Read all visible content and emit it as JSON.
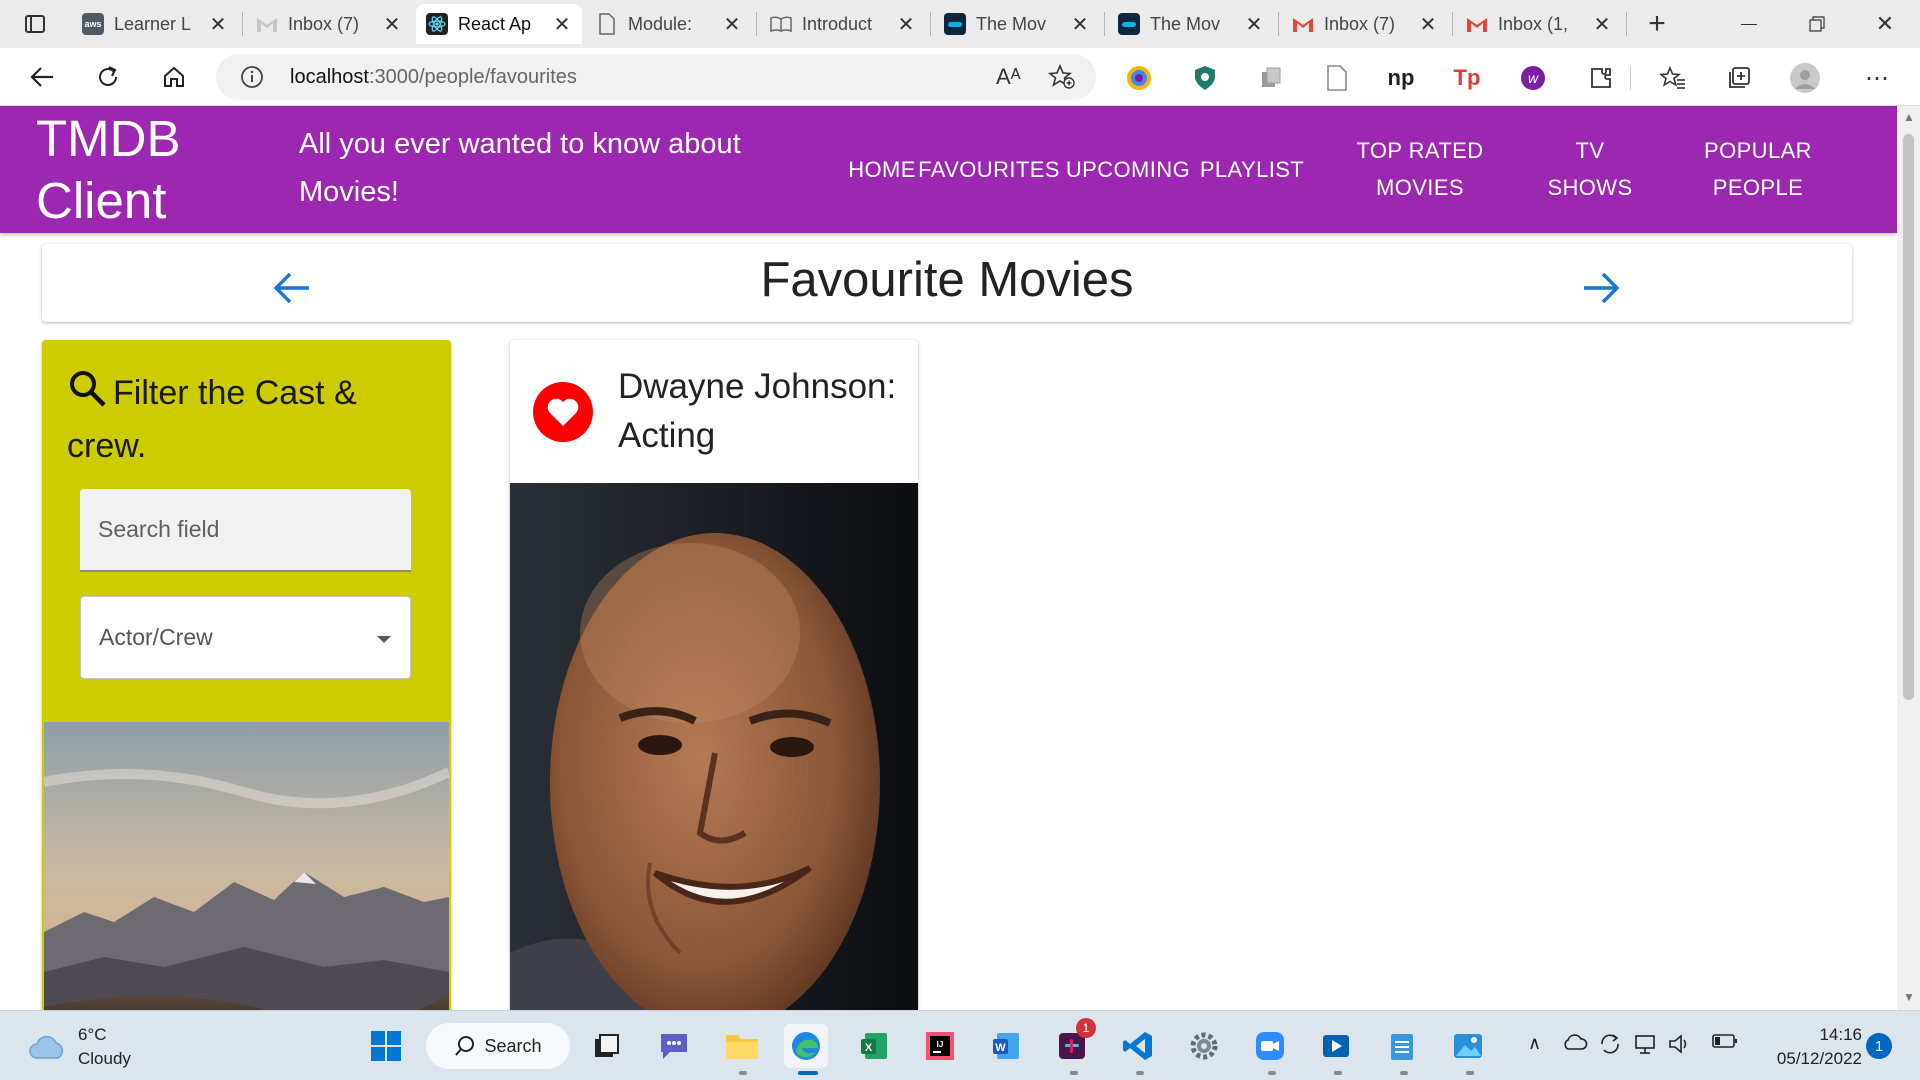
{
  "browser": {
    "tabs": [
      {
        "title": "Learner L",
        "icon": "aws-icon",
        "active": false
      },
      {
        "title": "Inbox (7)",
        "icon": "gmail-icon",
        "active": false
      },
      {
        "title": "React Ap",
        "icon": "react-icon",
        "active": true
      },
      {
        "title": "Module:",
        "icon": "document-icon",
        "active": false
      },
      {
        "title": "Introduct",
        "icon": "book-icon",
        "active": false
      },
      {
        "title": "The Mov",
        "icon": "tmdb-icon",
        "active": false
      },
      {
        "title": "The Mov",
        "icon": "tmdb-icon",
        "active": false
      },
      {
        "title": "Inbox (7)",
        "icon": "gmail-icon",
        "active": false
      },
      {
        "title": "Inbox (1,",
        "icon": "gmail-icon",
        "active": false
      }
    ],
    "new_tab_label": "+",
    "url_host": "localhost",
    "url_path": ":3000/people/favourites",
    "read_aloud_label": "Aᴬ"
  },
  "site": {
    "brand": "TMDB Client",
    "tagline": "All you ever wanted to know about Movies!",
    "menu": [
      "Home",
      "Favourites",
      "Upcoming",
      "Playlist",
      "Top Rated Movies",
      "TV Shows",
      "Popular People"
    ]
  },
  "page": {
    "title": "Favourite Movies"
  },
  "filter": {
    "title": "Filter the Cast & crew.",
    "search_placeholder": "Search field",
    "select_value": "Actor/Crew"
  },
  "person": {
    "name": "Dwayne Johnson: Acting"
  },
  "taskbar": {
    "temperature": "6°C",
    "condition": "Cloudy",
    "search_label": "Search",
    "time": "14:16",
    "date": "05/12/2022",
    "notification_count": "1",
    "teams_badge": "1"
  },
  "colors": {
    "appbar": "#9c27b0",
    "filter_card": "#cccc00",
    "arrow": "#1976d2",
    "heart_avatar": "#ff0000"
  }
}
